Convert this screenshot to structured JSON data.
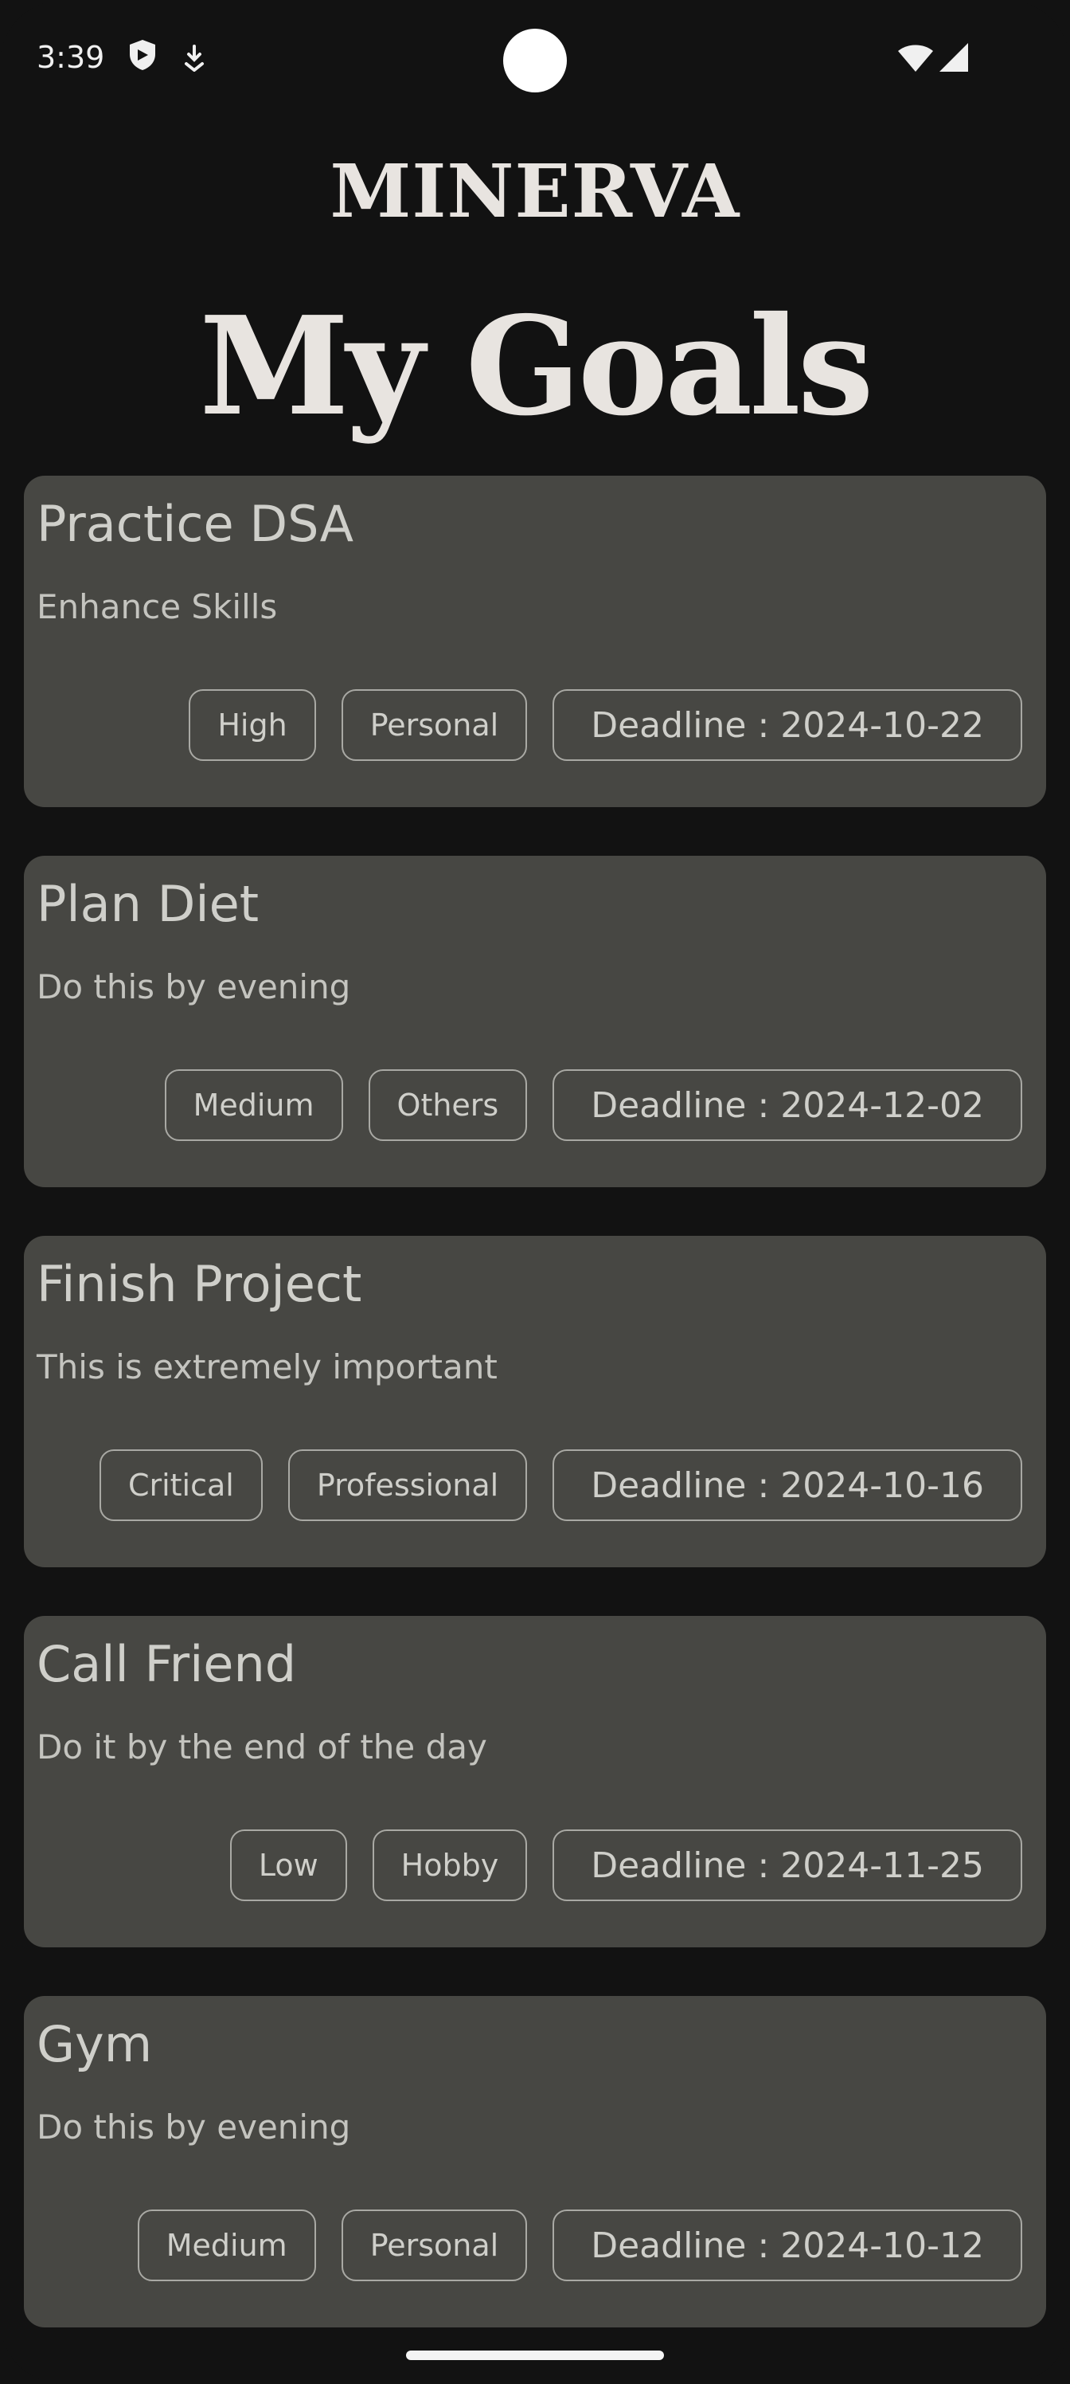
{
  "status_bar": {
    "time": "3:39",
    "icons": [
      "shield-icon",
      "download-icon",
      "wifi-icon",
      "cellular-signal-icon"
    ]
  },
  "header": {
    "brand": "MINERVA",
    "title": "My Goals"
  },
  "goals": [
    {
      "title": "Practice DSA",
      "description": "Enhance Skills",
      "priority": "High",
      "category": "Personal",
      "deadline": "Deadline : 2024-10-22"
    },
    {
      "title": "Plan Diet",
      "description": "Do this by evening",
      "priority": "Medium",
      "category": "Others",
      "deadline": "Deadline : 2024-12-02"
    },
    {
      "title": "Finish Project",
      "description": "This is extremely important",
      "priority": "Critical",
      "category": "Professional",
      "deadline": "Deadline : 2024-10-16"
    },
    {
      "title": "Call Friend",
      "description": "Do it by the end of the day",
      "priority": "Low",
      "category": "Hobby",
      "deadline": "Deadline : 2024-11-25"
    },
    {
      "title": "Gym",
      "description": "Do this by evening",
      "priority": "Medium",
      "category": "Personal",
      "deadline": "Deadline : 2024-10-12"
    }
  ],
  "colors": {
    "background": "#121212",
    "card": "#474743",
    "chip_border": "#a9a9a4",
    "text": "#cfcfca",
    "heading": "#e8e4e0"
  }
}
